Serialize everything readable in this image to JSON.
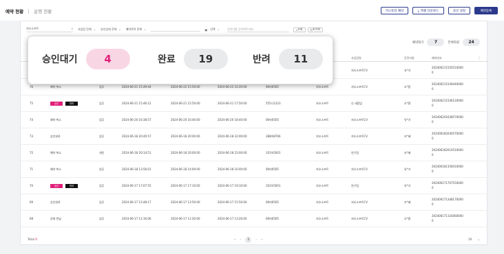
{
  "header": {
    "tab_active": "예약 현황",
    "tab_other": "운행 현황",
    "buttons": [
      "히스토리 예약",
      "엑셀 다운로드",
      "승인 설정",
      "예약등록"
    ]
  },
  "filters": {
    "search_label": "지오소프트",
    "selects": [
      "사업장 전체",
      "승인상태 전체",
      "예약목적 전체"
    ],
    "date_select": "선택",
    "query_placeholder": "검색어를 입력해주세요.",
    "search_btn": "조회",
    "reset_btn": "초기화"
  },
  "counts": {
    "wait_label": "예약대기",
    "wait": "7",
    "total_label": "전체차량",
    "total": "24"
  },
  "columns": {
    "no": "",
    "status": "",
    "purpose": "",
    "request": "",
    "start": "",
    "end": "",
    "car": "",
    "company": "",
    "site": "사업장명",
    "driver": "운전자명",
    "res_no": "예약번호"
  },
  "overlay": {
    "labels": [
      "승인대기",
      "완료",
      "반려"
    ],
    "values": [
      "4",
      "19",
      "11"
    ]
  },
  "action_labels": {
    "approve": "승인",
    "reject": "반려"
  },
  "rows": [
    {
      "no": "",
      "status": "",
      "purpose": "",
      "request": "",
      "start": "",
      "end": "",
      "car": "",
      "company": "",
      "site": "지오소프트CV",
      "driver": "유*기",
      "res_no": "2024062115505100000"
    },
    {
      "no": "76",
      "status": "예약 취소",
      "purpose": "업무",
      "request": "2024-06-21 15:49:44",
      "start": "2024-06-22 15:50:00",
      "end": "2024-06-22 16:20:00",
      "car": "06머0505",
      "company": "지오소프트",
      "site": "지오소프트CV",
      "driver": "오*환",
      "res_no": "2024062115494400000"
    },
    {
      "no": "75",
      "status": "",
      "purpose": "업무",
      "request": "2024-06-21 15:46:12",
      "start": "2024-06-21 15:50:00",
      "end": "2024-06-21 17:50:00",
      "car": "555나1223",
      "company": "지오소프트",
      "site": "신 세람업",
      "driver": "오*환",
      "res_no": "2024062115461200000"
    },
    {
      "no": "74",
      "status": "예약 취소",
      "purpose": "업무",
      "request": "2024-06-20 16:38:57",
      "start": "2024-06-20 16:40:00",
      "end": "2024-06-20 18:40:00",
      "car": "06머0505",
      "company": "지오소프트",
      "site": "지오소프트CV",
      "driver": "유*기",
      "res_no": "2024062016385700000"
    },
    {
      "no": "73",
      "status": "승인완료",
      "purpose": "업무",
      "request": "2024-06-18 20:40:57",
      "start": "2024-06-18 20:00:00",
      "end": "2024-06-18 22:00:00",
      "car": "288머8766",
      "company": "지오소프트",
      "site": "지오소프트CV",
      "driver": "조*혜",
      "res_no": "2024061820405700000"
    },
    {
      "no": "72",
      "status": "예약 취소",
      "purpose": "개인",
      "request": "2024-06-18 20:14:51",
      "start": "2024-06-18 20:00:00",
      "end": "2024-06-18 23:00:00",
      "car": "101허5001",
      "company": "지오소프트",
      "site": "연구팀",
      "driver": "조*혜",
      "res_no": "2024061820145100000"
    },
    {
      "no": "71",
      "status": "예약 취소",
      "purpose": "업무",
      "request": "2024-06-18 13:56:01",
      "start": "2024-06-18 14:00:00",
      "end": "2024-06-18 16:00:00",
      "car": "06머0505",
      "company": "지오소프트",
      "site": "지오소프트CV",
      "driver": "유*기",
      "res_no": "2024061813560100000"
    },
    {
      "no": "70",
      "status": "",
      "purpose": "업무",
      "request": "2024-06-17 17:07:55",
      "start": "2024-06-17 17:10:00",
      "end": "2024-06-17 19:10:00",
      "car": "101허5001",
      "company": "지오소프트",
      "site": "연구팀",
      "driver": "유*기",
      "res_no": "2024061717075500000"
    },
    {
      "no": "69",
      "status": "승인완료",
      "purpose": "업무",
      "request": "2024-06-17 13:48:17",
      "start": "2024-06-17 13:50:00",
      "end": "2024-06-17 15:50:00",
      "car": "06머0505",
      "company": "지오소프트",
      "site": "지오소프트CV",
      "driver": "조*혜",
      "res_no": "2024061713481700000"
    },
    {
      "no": "68",
      "status": "강제 반납",
      "purpose": "업무",
      "request": "2024-06-17 11:16:06",
      "start": "2024-06-17 11:20:00",
      "end": "2024-06-17 13:20:00",
      "car": "06머0505",
      "company": "지오소프트",
      "site": "지오소프트CV",
      "driver": "오*환",
      "res_no": "2024061711160600000"
    }
  ],
  "footer": {
    "total_label": "Total",
    "total_count": "0",
    "page": "1",
    "page_size": "10"
  }
}
